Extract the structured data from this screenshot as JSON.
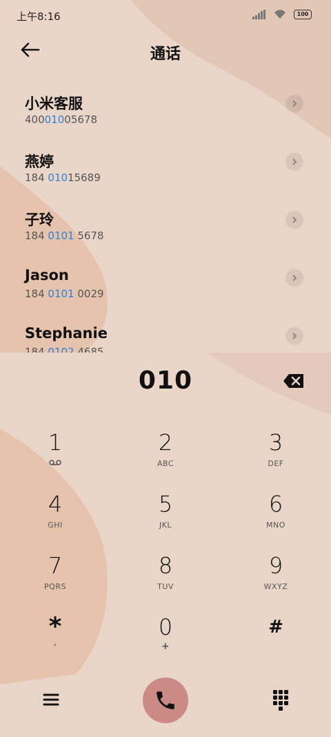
{
  "status_bar": {
    "time": "上午8:16",
    "battery": "100"
  },
  "header": {
    "title": "通话"
  },
  "contacts": [
    {
      "name": "小米客服",
      "number_pre": "400",
      "number_hl": "010",
      "number_post": "05678"
    },
    {
      "name": "燕婷",
      "number_pre": "184 ",
      "number_hl": "010",
      "number_post": "15689"
    },
    {
      "name": "子玲",
      "number_pre": "184 ",
      "number_hl": "0101",
      "number_post": " 5678"
    },
    {
      "name": "Jason",
      "number_pre": "184 ",
      "number_hl": "0101",
      "number_post": " 0029"
    },
    {
      "name": "Stephanie",
      "number_pre": "184 ",
      "number_hl": "0102",
      "number_post": " 4685"
    }
  ],
  "dialpad": {
    "dialed_number": "010",
    "keys": [
      {
        "digit": "1",
        "letters": ""
      },
      {
        "digit": "2",
        "letters": "ABC"
      },
      {
        "digit": "3",
        "letters": "DEF"
      },
      {
        "digit": "4",
        "letters": "GHI"
      },
      {
        "digit": "5",
        "letters": "JKL"
      },
      {
        "digit": "6",
        "letters": "MNO"
      },
      {
        "digit": "7",
        "letters": "PQRS"
      },
      {
        "digit": "8",
        "letters": "TUV"
      },
      {
        "digit": "9",
        "letters": "WXYZ"
      },
      {
        "digit": "*",
        "letters": ","
      },
      {
        "digit": "0",
        "letters": "+"
      },
      {
        "digit": "#",
        "letters": ""
      }
    ]
  },
  "colors": {
    "background": "#ead6c8",
    "highlight": "#2f7fd6",
    "call_button": "#cc8a86"
  },
  "icons": [
    "back-arrow-icon",
    "chevron-right-icon",
    "backspace-icon",
    "voicemail-icon",
    "menu-icon",
    "phone-icon",
    "dialpad-grid-icon"
  ]
}
